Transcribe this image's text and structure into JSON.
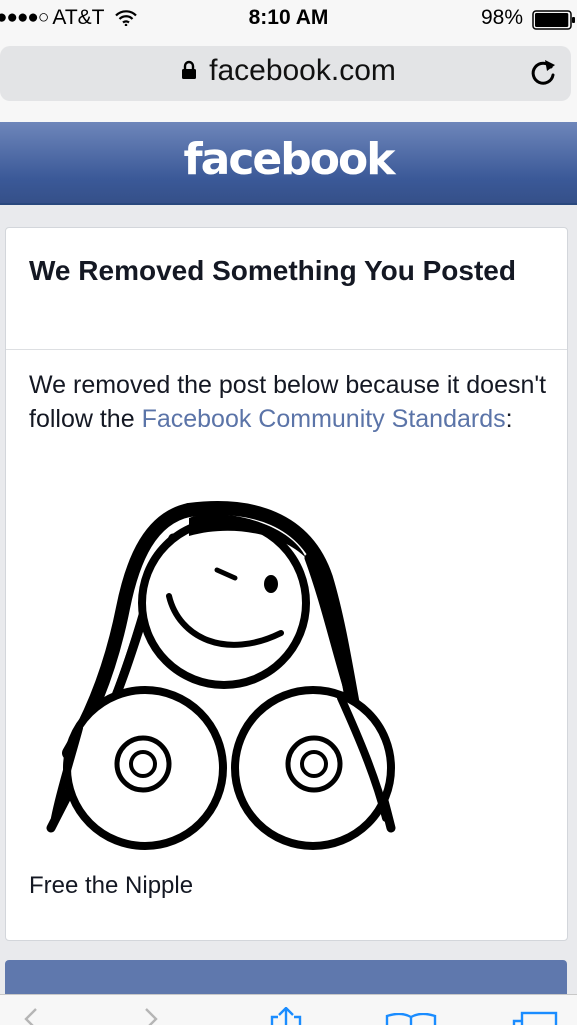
{
  "status_bar": {
    "signal": "●●●●○",
    "carrier": "AT&T",
    "time": "8:10 AM",
    "battery": "98%",
    "battery_level": 0.98
  },
  "browser": {
    "url": "facebook.com"
  },
  "header": {
    "logo": "facebook"
  },
  "notice": {
    "title": "We Removed Something You Posted",
    "message_before_link": "We removed the post below because it doesn't follow the ",
    "link_text": "Facebook Community Standards",
    "message_after_link": ":",
    "post_caption": "Free the Nipple"
  },
  "colors": {
    "brand_blue": "#3b5998",
    "link": "#5b74a8",
    "safari_blue": "#1a8cff"
  },
  "icons": {
    "wifi": "wifi-icon",
    "battery": "battery-icon",
    "lock": "lock-icon",
    "reload": "reload-icon",
    "back": "back-chevron-icon",
    "forward": "forward-chevron-icon",
    "share": "share-icon",
    "bookmarks": "bookmarks-icon",
    "tabs": "tabs-icon"
  }
}
